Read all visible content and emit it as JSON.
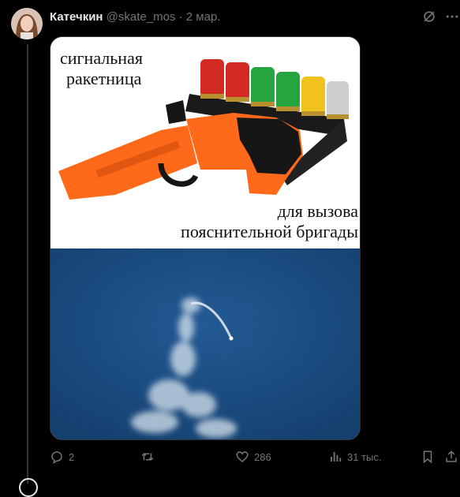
{
  "tweet": {
    "author_name": "Катечкин",
    "handle": "@skate_mos",
    "separator": "·",
    "date": "2 мар.",
    "icons": {
      "grok": "grok-icon",
      "more": "more-icon"
    }
  },
  "media": {
    "caption_top": [
      "сигнальная",
      "ракетница"
    ],
    "caption_bottom": [
      "для вызова",
      "пояснительной бригады"
    ],
    "colors": {
      "flare_gun": "#ff6a1a",
      "sky": "#1d4f86"
    },
    "shells": [
      "#d32a23",
      "#d32a23",
      "#26a43f",
      "#26a43f",
      "#f1c21b",
      "#cfcfcf"
    ]
  },
  "actions": {
    "replies": "2",
    "retweets": "",
    "likes": "286",
    "views": "31 тыс."
  }
}
